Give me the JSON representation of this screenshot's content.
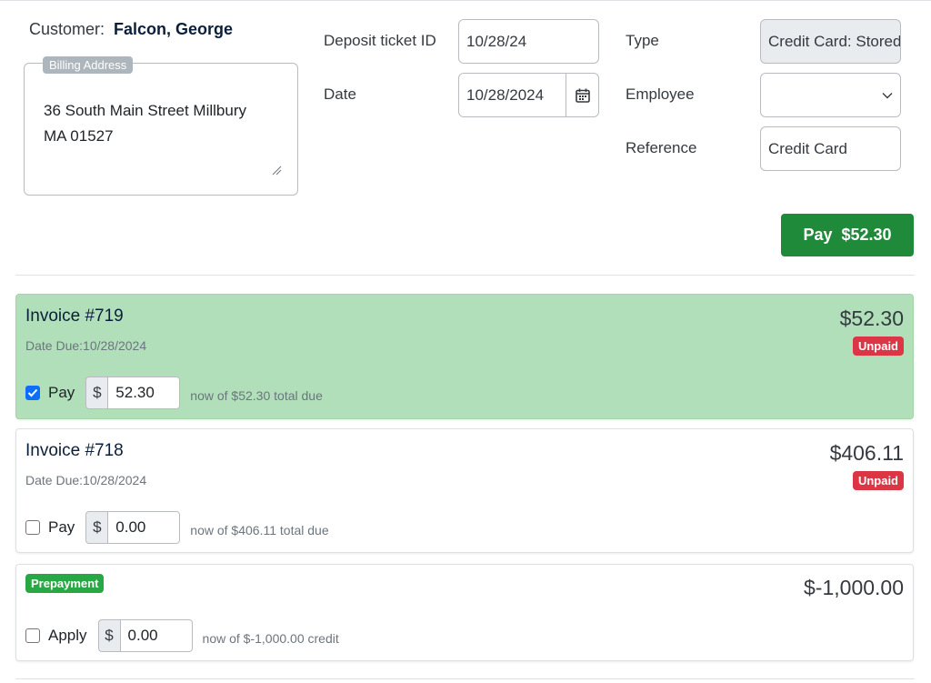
{
  "customer": {
    "label": "Customer:",
    "name": "Falcon, George",
    "billing_label": "Billing Address",
    "billing_address": "36 South Main Street  Millbury\nMA 01527"
  },
  "form": {
    "deposit_ticket_label": "Deposit ticket ID",
    "deposit_ticket_value": "10/28/24",
    "date_label": "Date",
    "date_value": "10/28/2024",
    "type_label": "Type",
    "type_value": "Credit Card: Stored",
    "employee_label": "Employee",
    "employee_value": "",
    "reference_label": "Reference",
    "reference_value": "Credit Card"
  },
  "pay_button_label": "Pay  $52.30",
  "invoices": [
    {
      "title": "Invoice #719",
      "due_date": "Date Due:10/28/2024",
      "amount": "$52.30",
      "status": "Unpaid",
      "checked": true,
      "check_label": "Pay",
      "currency": "$",
      "pay_value": "52.30",
      "note": "now of $52.30 total due"
    },
    {
      "title": "Invoice #718",
      "due_date": "Date Due:10/28/2024",
      "amount": "$406.11",
      "status": "Unpaid",
      "checked": false,
      "check_label": "Pay",
      "currency": "$",
      "pay_value": "0.00",
      "note": "now of $406.11 total due"
    }
  ],
  "prepayment": {
    "badge": "Prepayment",
    "amount": "$-1,000.00",
    "checked": false,
    "check_label": "Apply",
    "currency": "$",
    "apply_value": "0.00",
    "note": "now of $-1,000.00 credit"
  },
  "colors": {
    "selected_card": "#b1dfba",
    "pay_button": "#1e8a3a",
    "unpaid_badge": "#dc3545",
    "prepayment_badge": "#28a745",
    "checkbox_checked": "#0d6efd"
  }
}
